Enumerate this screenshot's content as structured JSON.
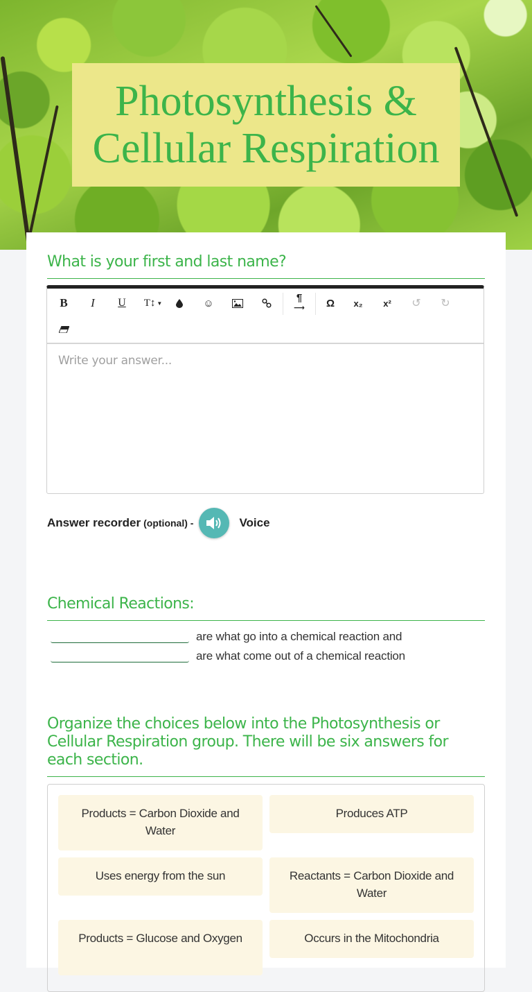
{
  "header": {
    "title_line1": "Photosynthesis &",
    "title_line2": "Cellular Respiration"
  },
  "questions": [
    {
      "title": "What is your first and last name?",
      "editor": {
        "placeholder": "Write your answer...",
        "toolbar": [
          {
            "name": "bold",
            "label": "B"
          },
          {
            "name": "italic",
            "label": "I"
          },
          {
            "name": "underline",
            "label": "U"
          },
          {
            "name": "font-size",
            "label": "T↕"
          },
          {
            "name": "text-color",
            "label": "💧"
          },
          {
            "name": "emoji",
            "label": "☺"
          },
          {
            "name": "image",
            "label": "▣"
          },
          {
            "name": "link",
            "label": "🔗"
          },
          {
            "name": "paragraph-direction",
            "label": "¶"
          },
          {
            "name": "special-character",
            "label": "Ω"
          },
          {
            "name": "subscript",
            "label": "x₂"
          },
          {
            "name": "superscript",
            "label": "x²"
          },
          {
            "name": "undo",
            "label": "↺"
          },
          {
            "name": "redo",
            "label": "↻"
          },
          {
            "name": "clear-formatting",
            "label": "▰"
          }
        ]
      },
      "recorder": {
        "label": "Answer recorder",
        "optional": "(optional) -",
        "voice_label": "Voice"
      }
    },
    {
      "title": "Chemical Reactions:",
      "blanks": [
        {
          "value": "",
          "text": "are what go into a chemical reaction and"
        },
        {
          "value": "",
          "text": "are what come out of a chemical reaction"
        }
      ]
    },
    {
      "title": "Organize the choices below into the Photosynthesis or Cellular Respiration group. There will be six answers for each section.",
      "choices": [
        "Products = Carbon Dioxide and Water",
        "Produces ATP",
        "Uses energy from the sun",
        "Reactants = Carbon Dioxide and Water",
        "Products = Glucose and Oxygen",
        "Occurs in the Mitochondria"
      ]
    }
  ],
  "colors": {
    "accent_green": "#3cb44a",
    "title_box": "#ece78a",
    "chip_bg": "#fcf6e3",
    "speaker": "#55b8b4"
  }
}
